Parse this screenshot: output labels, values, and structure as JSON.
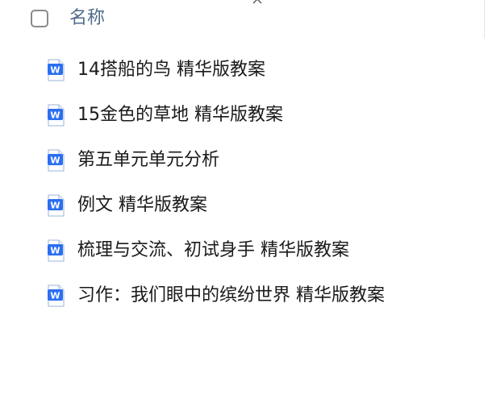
{
  "header": {
    "label": "名称"
  },
  "files": [
    {
      "name": "14搭船的鸟 精华版教案",
      "icon": "word-doc-icon"
    },
    {
      "name": "15金色的草地 精华版教案",
      "icon": "word-doc-icon"
    },
    {
      "name": "第五单元单元分析",
      "icon": "word-doc-icon"
    },
    {
      "name": "例文 精华版教案",
      "icon": "word-doc-icon"
    },
    {
      "name": "梳理与交流、初试身手 精华版教案",
      "icon": "word-doc-icon"
    },
    {
      "name": "习作：我们眼中的缤纷世界 精华版教案",
      "icon": "word-doc-icon"
    }
  ],
  "colors": {
    "word_blue": "#2b6ff2",
    "header_text": "#4f6a8a",
    "file_text": "#1a1a1a"
  }
}
